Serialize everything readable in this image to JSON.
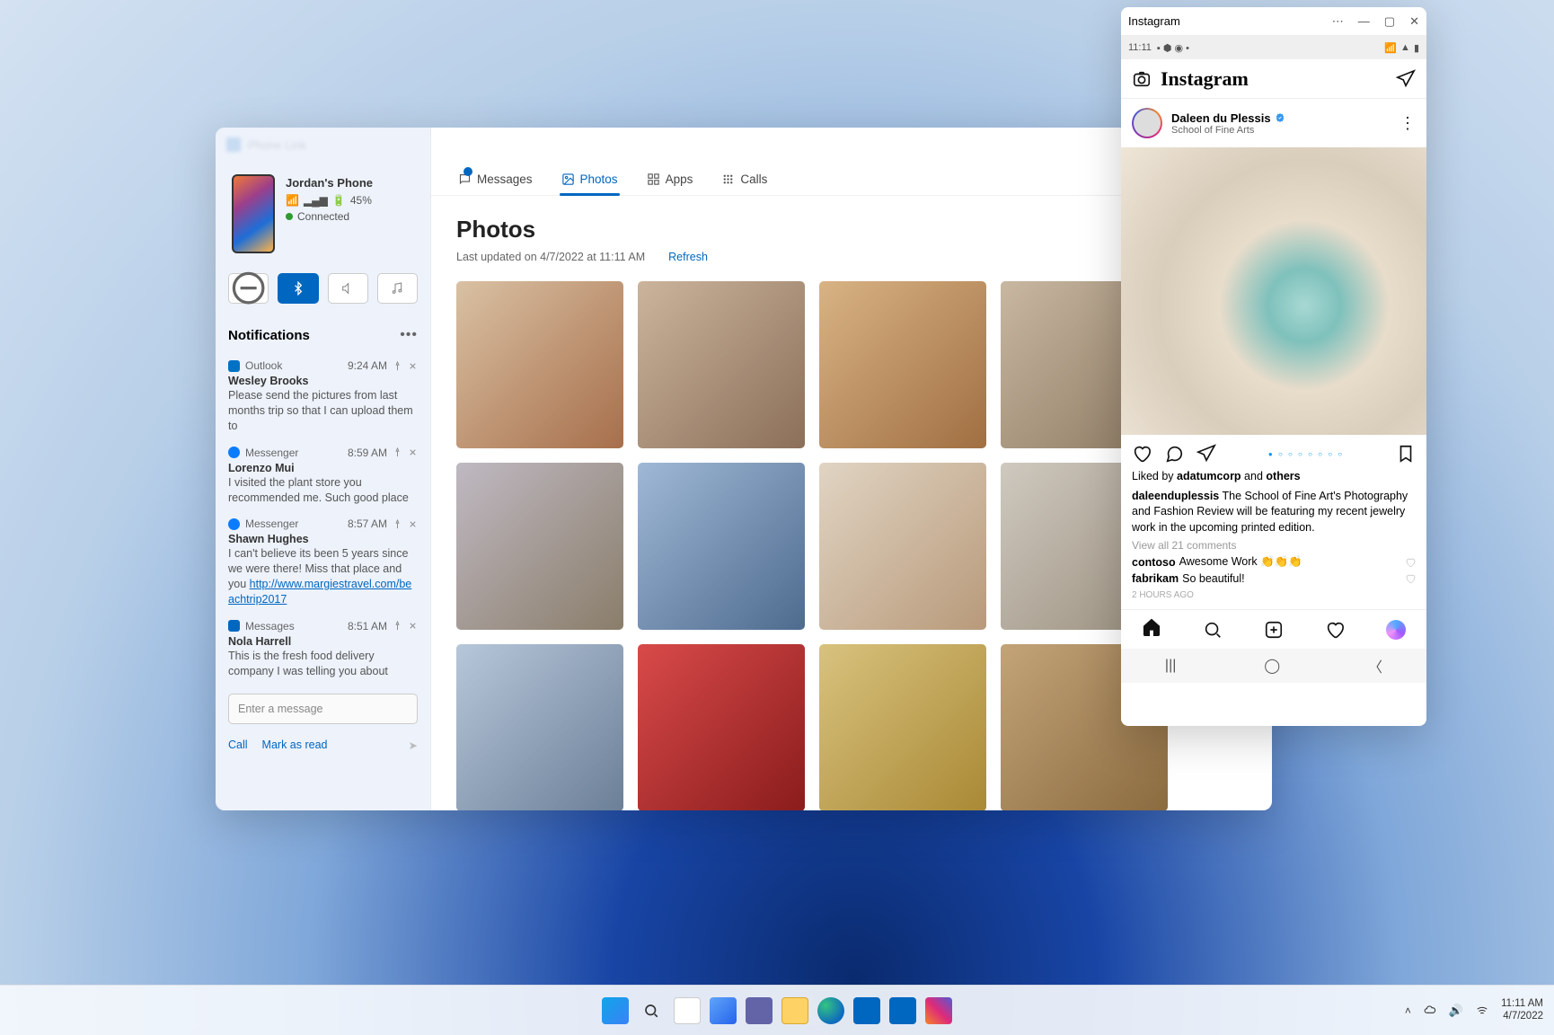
{
  "phone_link": {
    "title": "Phone Link",
    "device": {
      "name": "Jordan's Phone",
      "battery": "45%",
      "status": "Connected"
    },
    "tabs": {
      "messages": "Messages",
      "photos": "Photos",
      "apps": "Apps",
      "calls": "Calls"
    },
    "photos": {
      "heading": "Photos",
      "updated": "Last updated on 4/7/2022 at 11:11 AM",
      "refresh": "Refresh"
    },
    "notifications_header": "Notifications",
    "notifications": [
      {
        "app": "Outlook",
        "appClass": "outlook",
        "time": "9:24 AM",
        "sender": "Wesley Brooks",
        "body": "Please send the pictures from last months trip so that I can upload them to"
      },
      {
        "app": "Messenger",
        "appClass": "messenger",
        "time": "8:59 AM",
        "sender": "Lorenzo Mui",
        "body": "I visited the plant store you recommended me. Such good place"
      },
      {
        "app": "Messenger",
        "appClass": "messenger",
        "time": "8:57 AM",
        "sender": "Shawn Hughes",
        "body": "I can't believe its been 5 years since we were there! Miss that place and you ",
        "link": "http://www.margiestravel.com/beachtrip2017"
      },
      {
        "app": "Messages",
        "appClass": "messages",
        "time": "8:51 AM",
        "sender": "Nola Harrell",
        "body": "This is the fresh food delivery company I was telling you about"
      }
    ],
    "msg_placeholder": "Enter a message",
    "footer": {
      "call": "Call",
      "mark_read": "Mark as read"
    }
  },
  "instagram": {
    "title": "Instagram",
    "status_time": "11:11",
    "logo": "Instagram",
    "poster": {
      "name": "Daleen du Plessis",
      "sub": "School of Fine Arts"
    },
    "liked_prefix": "Liked by ",
    "liked_user": "adatumcorp",
    "liked_suffix": " and ",
    "liked_others": "others",
    "caption_user": "daleenduplessis",
    "caption_body": "  The School of Fine Art's Photography and Fashion Review will be featuring my recent jewelry work in the upcoming printed edition.",
    "view_comments": "View all 21 comments",
    "comments": [
      {
        "user": "contoso",
        "text": "Awesome Work 👏👏👏"
      },
      {
        "user": "fabrikam",
        "text": "So beautiful!"
      }
    ],
    "time": "2 HOURS AGO"
  },
  "taskbar": {
    "time": "11:11 AM",
    "date": "4/7/2022"
  }
}
